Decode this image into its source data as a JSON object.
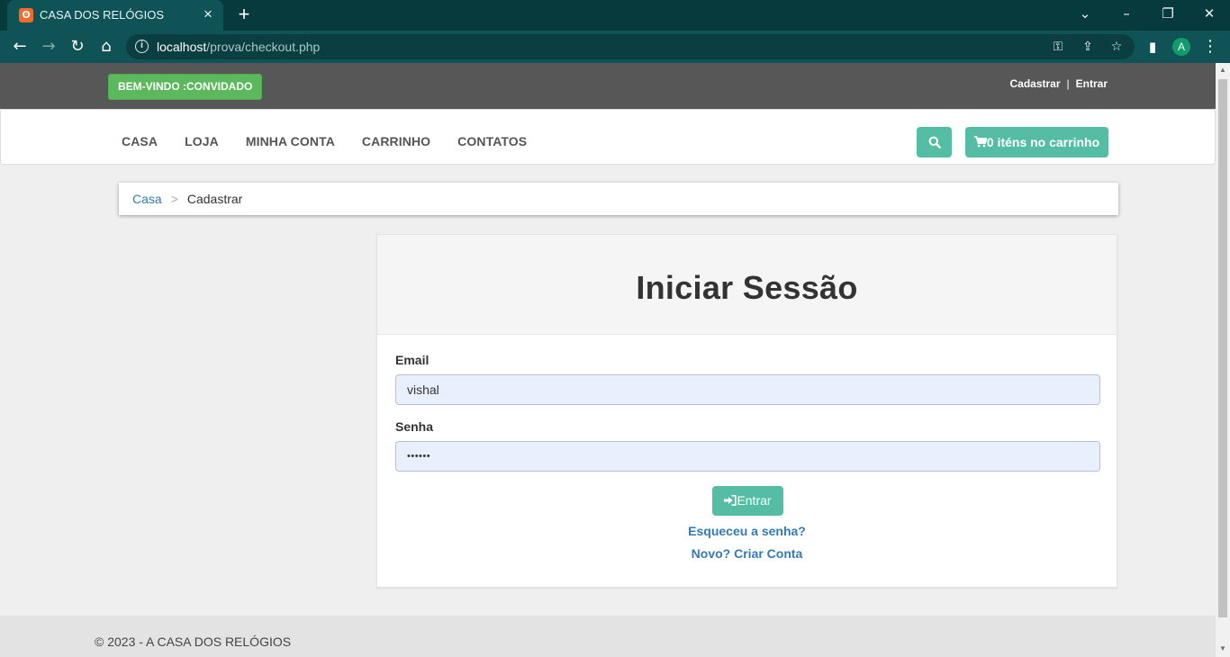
{
  "browser": {
    "tab_title": "CASA DOS RELÓGIOS",
    "tab_favicon": "xampp-icon",
    "url_host": "localhost",
    "url_path": "/prova/checkout.php",
    "profile_initial": "A"
  },
  "topbar": {
    "welcome": "BEM-VINDO :CONVIDADO",
    "register_link": "Cadastrar",
    "separator": "|",
    "login_link": "Entrar"
  },
  "nav": {
    "items": [
      "CASA",
      "LOJA",
      "MINHA CONTA",
      "CARRINHO",
      "CONTATOS"
    ],
    "cart_label": "0 iténs no carrinho"
  },
  "breadcrumb": {
    "home": "Casa",
    "separator": ">",
    "current": "Cadastrar"
  },
  "login": {
    "title": "Iniciar Sessão",
    "email_label": "Email",
    "email_value": "vishal",
    "password_label": "Senha",
    "password_value": "••••••",
    "submit_label": "Entrar",
    "forgot_link": "Esqueceu a senha?",
    "create_link": "Novo? Criar Conta"
  },
  "footer": {
    "text": "© 2023 - A CASA DOS RELÓGIOS"
  },
  "colors": {
    "accent": "#55bda4",
    "welcome_green": "#5cb85c",
    "topbar": "#575757",
    "link": "#337ab7"
  }
}
